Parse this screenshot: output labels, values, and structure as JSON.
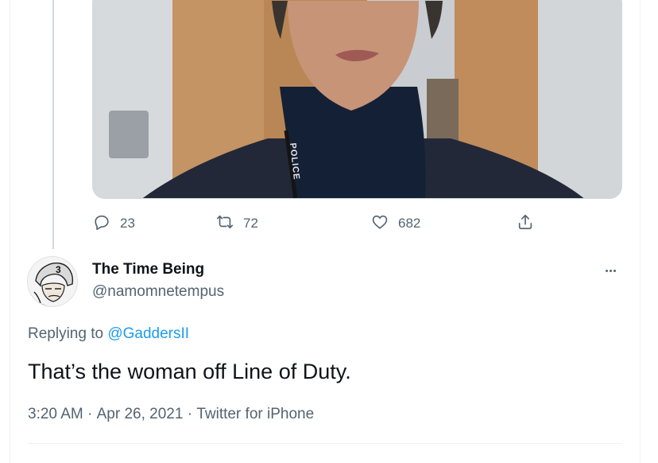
{
  "actions": {
    "reply_count": "23",
    "retweet_count": "72",
    "like_count": "682"
  },
  "tweet": {
    "display_name": "The Time Being",
    "handle": "@namomnetempus",
    "replying_prefix": "Replying to ",
    "replying_to": "@GaddersII",
    "text": "That’s the woman off Line of Duty.",
    "time": "3:20 AM",
    "separator": " · ",
    "date": "Apr 26, 2021",
    "source": "Twitter for iPhone"
  },
  "media": {
    "lanyard_text": "POLICE"
  },
  "icons": {
    "reply": "reply-icon",
    "retweet": "retweet-icon",
    "like": "like-icon",
    "share": "share-icon",
    "more": "more-icon"
  },
  "colors": {
    "link": "#1d9bf0",
    "secondary_text": "#536471",
    "primary_text": "#0f1419"
  }
}
